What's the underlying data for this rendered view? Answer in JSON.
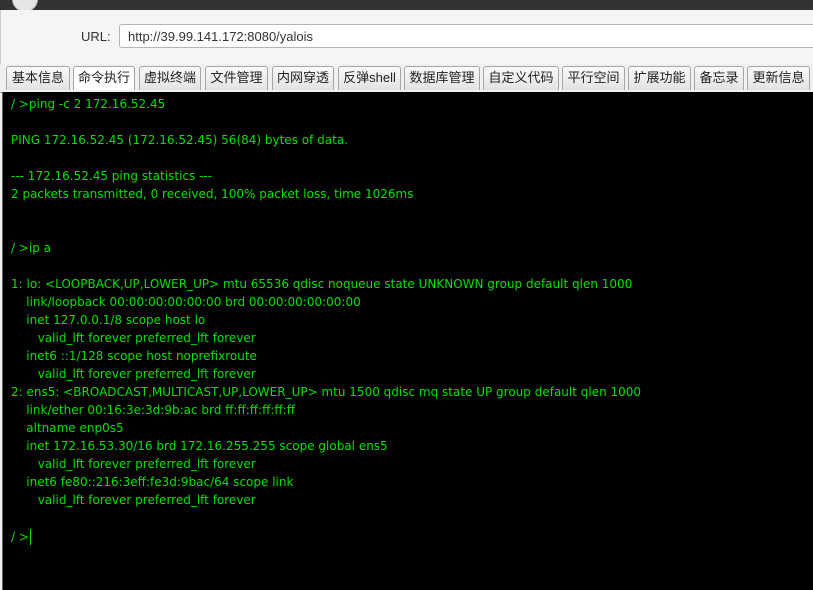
{
  "address_bar": {
    "label": "URL:",
    "value": "http://39.99.141.172:8080/yalois"
  },
  "tabs": [
    {
      "label": "基本信息"
    },
    {
      "label": "命令执行"
    },
    {
      "label": "虚拟终端"
    },
    {
      "label": "文件管理"
    },
    {
      "label": "内网穿透"
    },
    {
      "label": "反弹shell"
    },
    {
      "label": "数据库管理"
    },
    {
      "label": "自定义代码"
    },
    {
      "label": "平行空间"
    },
    {
      "label": "扩展功能"
    },
    {
      "label": "备忘录"
    },
    {
      "label": "更新信息"
    }
  ],
  "active_tab": "命令执行",
  "terminal": {
    "text_color": "#00e000",
    "background": "#000000",
    "lines": [
      "/ >ping -c 2 172.16.52.45",
      "PING 172.16.52.45 (172.16.52.45) 56(84) bytes of data.",
      "--- 172.16.52.45 ping statistics ---",
      "2 packets transmitted, 0 received, 100% packet loss, time 1026ms",
      "/ >ip a",
      "1: lo: <LOOPBACK,UP,LOWER_UP> mtu 65536 qdisc noqueue state UNKNOWN group default qlen 1000",
      "    link/loopback 00:00:00:00:00:00 brd 00:00:00:00:00:00",
      "    inet 127.0.0.1/8 scope host lo",
      "       valid_lft forever preferred_lft forever",
      "    inet6 ::1/128 scope host noprefixroute",
      "       valid_lft forever preferred_lft forever",
      "2: ens5: <BROADCAST,MULTICAST,UP,LOWER_UP> mtu 1500 qdisc mq state UP group default qlen 1000",
      "    link/ether 00:16:3e:3d:9b:ac brd ff:ff:ff:ff:ff:ff",
      "    altname enp0s5",
      "    inet 172.16.53.30/16 brd 172.16.255.255 scope global ens5",
      "       valid_lft forever preferred_lft forever",
      "    inet6 fe80::216:3eff:fe3d:9bac/64 scope link",
      "       valid_lft forever preferred_lft forever",
      "/ >"
    ]
  }
}
